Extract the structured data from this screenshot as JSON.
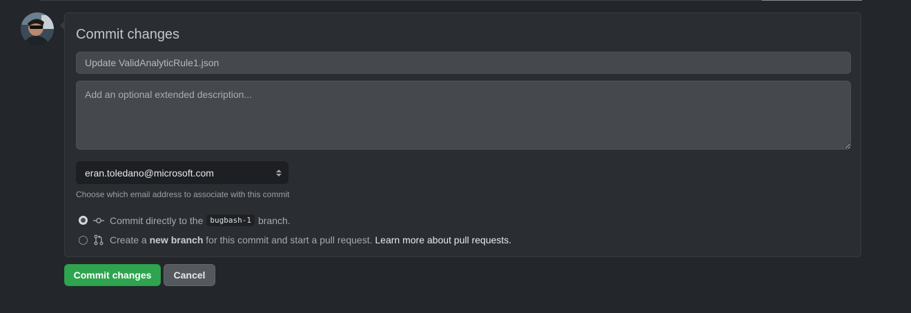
{
  "commit_form": {
    "title": "Commit changes",
    "summary_placeholder": "Update ValidAnalyticRule1.json",
    "description_placeholder": "Add an optional extended description...",
    "email": {
      "selected": "eran.toledano@microsoft.com",
      "note": "Choose which email address to associate with this commit"
    },
    "option_direct": {
      "prefix": "Commit directly to the",
      "branch": "bugbash-1",
      "suffix": "branch.",
      "selected": true
    },
    "option_new_branch": {
      "prefix": "Create a",
      "emphasis": "new branch",
      "middle": "for this commit and start a pull request.",
      "link": "Learn more about pull requests.",
      "selected": false
    }
  },
  "buttons": {
    "commit_label": "Commit changes",
    "cancel_label": "Cancel"
  },
  "colors": {
    "background": "#23262a",
    "card": "#2a2d31",
    "commit_button": "#2ea44f",
    "cancel_button": "#55585d"
  },
  "icons": {
    "direct_commit": "git-commit-icon",
    "pull_request": "git-pull-request-icon"
  }
}
